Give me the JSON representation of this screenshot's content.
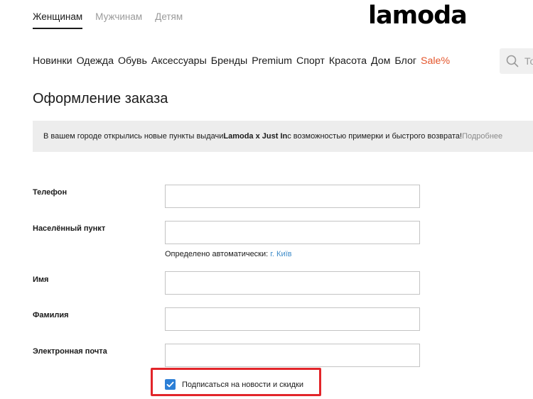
{
  "gender_tabs": [
    {
      "label": "Женщинам",
      "active": true
    },
    {
      "label": "Мужчинам",
      "active": false
    },
    {
      "label": "Детям",
      "active": false
    }
  ],
  "logo": "lamoda",
  "nav": {
    "items": [
      "Новинки",
      "Одежда",
      "Обувь",
      "Аксессуары",
      "Бренды",
      "Premium",
      "Спорт",
      "Красота",
      "Дом",
      "Блог"
    ],
    "sale": "Sale%"
  },
  "search": {
    "placeholder": "То"
  },
  "page_title": "Оформление заказа",
  "banner": {
    "text_before": "В вашем городе открылись новые пункты выдачи ",
    "brand": "Lamoda x Just In",
    "text_after": " с возможностью примерки и быстрого возврата! ",
    "link": "Подробнее"
  },
  "form": {
    "phone_label": "Телефон",
    "city_label": "Населённый пункт",
    "city_auto_text": "Определено автоматически: ",
    "city_auto_value": "г. Київ",
    "name_label": "Имя",
    "surname_label": "Фамилия",
    "email_label": "Электронная почта",
    "subscribe_label": "Подписаться на новости и скидки",
    "subscribe_checked": true
  },
  "colors": {
    "sale": "#e4552b",
    "checkbox": "#2c7fd6",
    "highlight": "#e2252a",
    "city_link": "#3d8bc9"
  },
  "icons": {
    "search": "search-icon",
    "check": "check-icon"
  }
}
